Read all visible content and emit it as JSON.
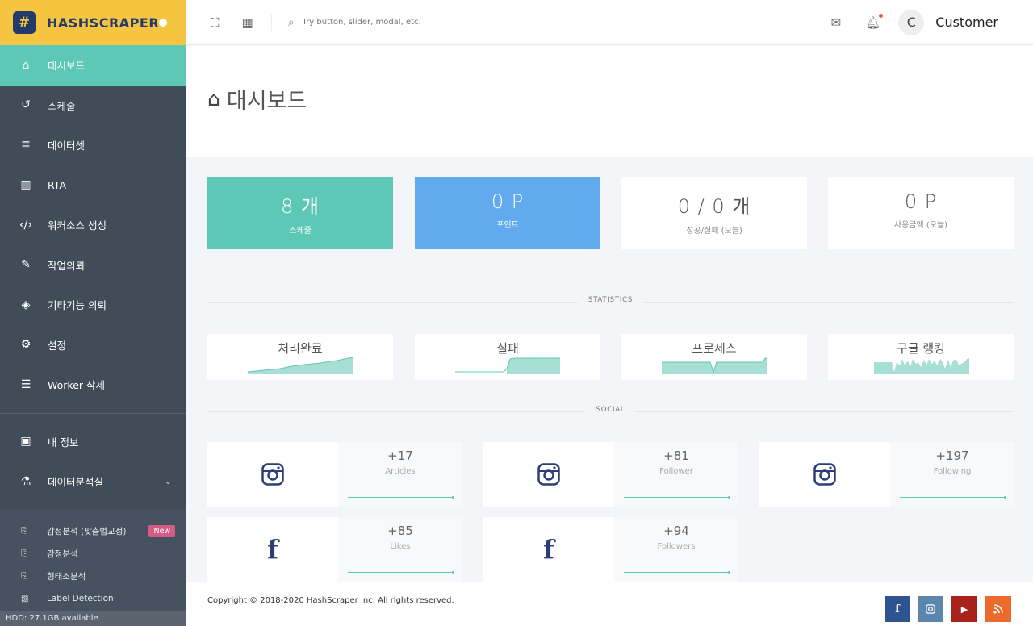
{
  "brand": {
    "name": "HASHSCRAPER",
    "logo_icon": "hash-logo-icon"
  },
  "sidebar": {
    "items": [
      {
        "label": "대시보드",
        "icon": "home-icon",
        "active": true
      },
      {
        "label": "스케줄",
        "icon": "history-icon"
      },
      {
        "label": "데이터셋",
        "icon": "database-icon"
      },
      {
        "label": "RTA",
        "icon": "bar-chart-icon"
      },
      {
        "label": "워커소스 생성",
        "icon": "code-icon"
      },
      {
        "label": "작업의뢰",
        "icon": "edit-icon"
      },
      {
        "label": "기타기능 의뢰",
        "icon": "cube-icon"
      },
      {
        "label": "설정",
        "icon": "gear-icon"
      },
      {
        "label": "Worker 삭제",
        "icon": "server-icon"
      }
    ],
    "bottom_items": [
      {
        "label": "내 정보",
        "icon": "user-card-icon"
      },
      {
        "label": "데이터분석실",
        "icon": "flask-icon"
      }
    ],
    "sub_items": [
      {
        "label": "감정분석 (맞춤법교정)",
        "badge": "New"
      },
      {
        "label": "감정분석"
      },
      {
        "label": "형태소분석"
      },
      {
        "label": "Label Detection"
      }
    ],
    "hdd": "HDD: 27.1GB available."
  },
  "header": {
    "search_placeholder": "Try button, slider, modal, etc.",
    "avatar_initial": "C",
    "user_name": "Customer"
  },
  "page": {
    "title": "대시보드"
  },
  "stats": [
    {
      "value": "8 개",
      "label": "스케줄"
    },
    {
      "value": "0 P",
      "label": "포인트"
    },
    {
      "value": "0 / 0 개",
      "label": "성공/실패 (오늘)"
    },
    {
      "value": "0 P",
      "label": "사용금액 (오늘)"
    }
  ],
  "sections": {
    "statistics": "STATISTICS",
    "social": "SOCIAL"
  },
  "sparks": [
    {
      "label": "처리완료"
    },
    {
      "label": "실패"
    },
    {
      "label": "프로세스"
    },
    {
      "label": "구글 랭킹"
    }
  ],
  "social": [
    {
      "icon": "instagram-icon",
      "value": "+17",
      "label": "Articles"
    },
    {
      "icon": "instagram-icon",
      "value": "+81",
      "label": "Follower"
    },
    {
      "icon": "instagram-icon",
      "value": "+197",
      "label": "Following"
    },
    {
      "icon": "facebook-icon",
      "value": "+85",
      "label": "Likes"
    },
    {
      "icon": "facebook-icon",
      "value": "+94",
      "label": "Followers"
    }
  ],
  "footer": {
    "copyright": "Copyright © 2018-2020 HashScraper Inc. All rights reserved.",
    "buttons": [
      {
        "icon": "facebook-icon",
        "color": "#2d5391"
      },
      {
        "icon": "instagram-icon",
        "color": "#5b86ad"
      },
      {
        "icon": "youtube-icon",
        "color": "#a8231c"
      },
      {
        "icon": "rss-icon",
        "color": "#ec6a2c"
      }
    ]
  },
  "colors": {
    "accent": "#5ec8b7",
    "brand": "#f5c542",
    "blue": "#62aaee",
    "sidebar": "#414c59"
  }
}
